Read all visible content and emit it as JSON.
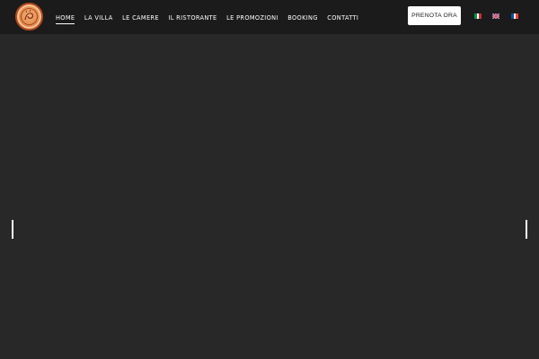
{
  "header": {
    "logo_icon": "villa-logo-icon",
    "nav": [
      {
        "label": "HOME",
        "active": true
      },
      {
        "label": "LA VILLA",
        "active": false
      },
      {
        "label": "LE CAMERE",
        "active": false
      },
      {
        "label": "IL RISTORANTE",
        "active": false
      },
      {
        "label": "LE PROMOZIONI",
        "active": false
      },
      {
        "label": "BOOKING",
        "active": false
      },
      {
        "label": "CONTATTI",
        "active": false
      }
    ],
    "cta_label": "PRENOTA ORA",
    "languages": [
      {
        "icon": "italian-flag-icon",
        "colors": [
          "#009246",
          "#ffffff",
          "#ce2b37"
        ]
      },
      {
        "icon": "uk-flag-icon",
        "colors": [
          "#012169",
          "#ffffff",
          "#c8102e"
        ]
      },
      {
        "icon": "french-flag-icon",
        "colors": [
          "#0055a4",
          "#ffffff",
          "#ef4135"
        ]
      }
    ]
  },
  "hero": {
    "background_color": "#282828",
    "prev_icon": "slider-prev-icon",
    "next_icon": "slider-next-icon"
  },
  "colors": {
    "header_bg": "#1b1b1b",
    "page_bg": "#282828",
    "nav_text": "#ffffff",
    "cta_bg": "#ffffff",
    "cta_text": "#1b1b1b",
    "logo_accent": "#e48b4d"
  }
}
